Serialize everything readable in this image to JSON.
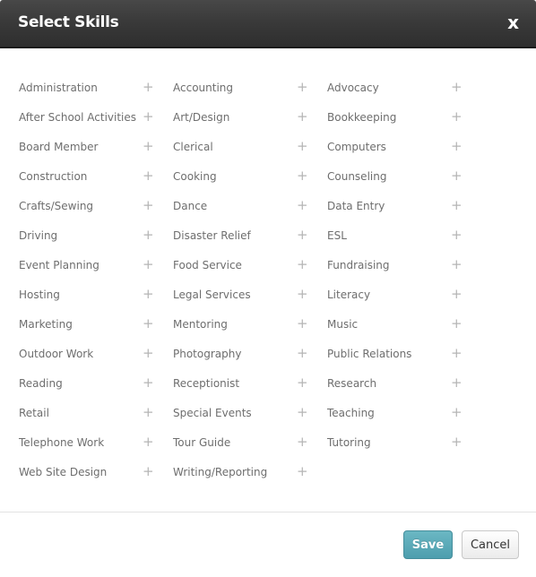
{
  "dialog": {
    "title": "Select Skills",
    "close_label": "x"
  },
  "columns": [
    {
      "skills": [
        {
          "label": "Administration",
          "icon": "plus-icon"
        },
        {
          "label": "After School Activities",
          "icon": "plus-icon"
        },
        {
          "label": "Board Member",
          "icon": "plus-icon"
        },
        {
          "label": "Construction",
          "icon": "plus-icon"
        },
        {
          "label": "Crafts/Sewing",
          "icon": "plus-icon"
        },
        {
          "label": "Driving",
          "icon": "plus-icon"
        },
        {
          "label": "Event Planning",
          "icon": "plus-icon"
        },
        {
          "label": "Hosting",
          "icon": "plus-icon"
        },
        {
          "label": "Marketing",
          "icon": "plus-icon"
        },
        {
          "label": "Outdoor Work",
          "icon": "plus-icon"
        },
        {
          "label": "Reading",
          "icon": "plus-icon"
        },
        {
          "label": "Retail",
          "icon": "plus-icon"
        },
        {
          "label": "Telephone Work",
          "icon": "plus-icon"
        },
        {
          "label": "Web Site Design",
          "icon": "plus-icon"
        }
      ]
    },
    {
      "skills": [
        {
          "label": "Accounting",
          "icon": "plus-icon"
        },
        {
          "label": "Art/Design",
          "icon": "plus-icon"
        },
        {
          "label": "Clerical",
          "icon": "plus-icon"
        },
        {
          "label": "Cooking",
          "icon": "plus-icon"
        },
        {
          "label": "Dance",
          "icon": "plus-icon"
        },
        {
          "label": "Disaster Relief",
          "icon": "plus-icon"
        },
        {
          "label": "Food Service",
          "icon": "plus-icon"
        },
        {
          "label": "Legal Services",
          "icon": "plus-icon"
        },
        {
          "label": "Mentoring",
          "icon": "plus-icon"
        },
        {
          "label": "Photography",
          "icon": "plus-icon"
        },
        {
          "label": "Receptionist",
          "icon": "plus-icon"
        },
        {
          "label": "Special Events",
          "icon": "plus-icon"
        },
        {
          "label": "Tour Guide",
          "icon": "plus-icon"
        },
        {
          "label": "Writing/Reporting",
          "icon": "plus-icon"
        }
      ]
    },
    {
      "skills": [
        {
          "label": "Advocacy",
          "icon": "plus-icon"
        },
        {
          "label": "Bookkeeping",
          "icon": "plus-icon"
        },
        {
          "label": "Computers",
          "icon": "plus-icon"
        },
        {
          "label": "Counseling",
          "icon": "plus-icon"
        },
        {
          "label": "Data Entry",
          "icon": "plus-icon"
        },
        {
          "label": "ESL",
          "icon": "plus-icon"
        },
        {
          "label": "Fundraising",
          "icon": "plus-icon"
        },
        {
          "label": "Literacy",
          "icon": "plus-icon"
        },
        {
          "label": "Music",
          "icon": "plus-icon"
        },
        {
          "label": "Public Relations",
          "icon": "plus-icon"
        },
        {
          "label": "Research",
          "icon": "plus-icon"
        },
        {
          "label": "Teaching",
          "icon": "plus-icon"
        },
        {
          "label": "Tutoring",
          "icon": "plus-icon"
        }
      ]
    }
  ],
  "plus_glyph": "+",
  "footer": {
    "save_label": "Save",
    "cancel_label": "Cancel"
  },
  "colors": {
    "header_bg": "#3a3a3a",
    "save_bg": "#5aa8b7",
    "skill_text": "#6e6e6e",
    "plus_icon": "#b5b5b5"
  }
}
